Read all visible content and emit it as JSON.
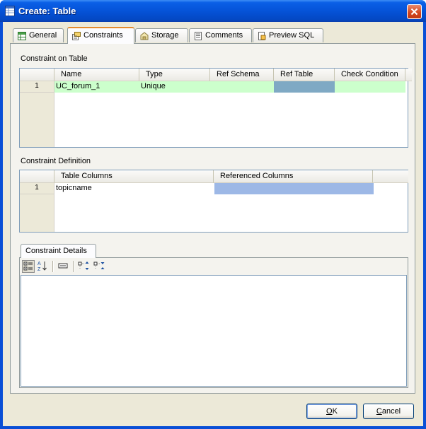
{
  "window": {
    "title": "Create: Table"
  },
  "tabs": [
    {
      "label": "General",
      "icon": "table-grid-icon"
    },
    {
      "label": "Constraints",
      "icon": "constraint-icon"
    },
    {
      "label": "Storage",
      "icon": "storage-icon"
    },
    {
      "label": "Comments",
      "icon": "comments-icon"
    },
    {
      "label": "Preview SQL",
      "icon": "sql-document-icon"
    }
  ],
  "active_tab": "Constraints",
  "constraints": {
    "label": "Constraint on Table",
    "columns": [
      "Name",
      "Type",
      "Ref Schema",
      "Ref Table",
      "Check Condition"
    ],
    "rows": [
      {
        "num": "1",
        "name": "UC_forum_1",
        "type": "Unique",
        "ref_schema": "",
        "ref_table": "",
        "check_condition": ""
      }
    ]
  },
  "definition": {
    "label": "Constraint Definition",
    "columns": [
      "Table Columns",
      "Referenced Columns"
    ],
    "rows": [
      {
        "num": "1",
        "table_column": "topicname",
        "referenced_column": ""
      }
    ]
  },
  "details": {
    "tab_label": "Constraint Details",
    "toolbar": [
      "categorized-view-icon",
      "sort-alphabetical-icon",
      "description-icon",
      "expand-all-icon",
      "collapse-all-icon"
    ]
  },
  "buttons": {
    "ok": {
      "pre": "",
      "mnemonic": "O",
      "post": "K"
    },
    "cancel": {
      "pre": "",
      "mnemonic": "C",
      "post": "ancel"
    }
  },
  "colors": {
    "selected_row": "#ccffcc",
    "ref_table_cell": "#7fa9c4",
    "referenced_cell": "#9db8e6",
    "title_bar": "#0553d8",
    "active_tab_accent": "#e68b2c"
  }
}
